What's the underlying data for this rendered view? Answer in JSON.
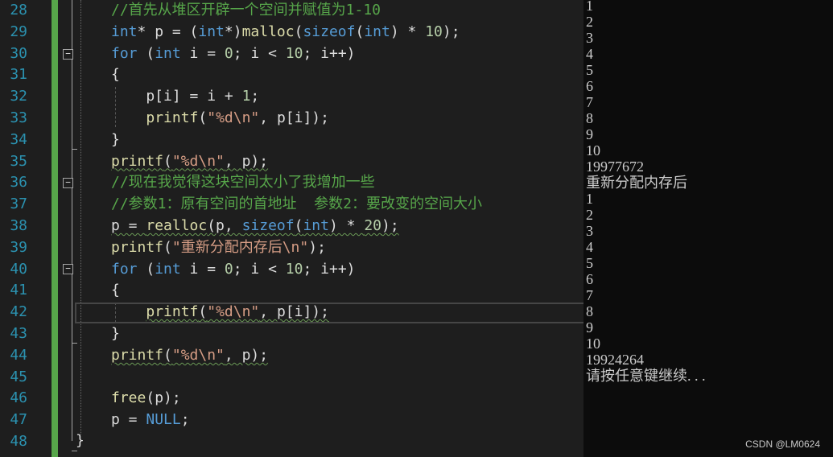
{
  "colors": {
    "keyword": "#569cd6",
    "comment": "#57a64a",
    "string": "#d69d85",
    "identifier": "#dcdcdc",
    "function": "#dcdcaa",
    "number": "#b5cea8",
    "line_number": "#2b91af"
  },
  "editor": {
    "lines": [
      {
        "num": "28",
        "tokens": [
          {
            "t": "//首先从堆区开辟一个空间并赋值为1-10",
            "c": "comment"
          }
        ]
      },
      {
        "num": "29",
        "tokens": [
          {
            "t": "int",
            "c": "keyword"
          },
          {
            "t": "* p = (",
            "c": "identifier"
          },
          {
            "t": "int",
            "c": "keyword"
          },
          {
            "t": "*)",
            "c": "identifier"
          },
          {
            "t": "malloc",
            "c": "function"
          },
          {
            "t": "(",
            "c": "identifier"
          },
          {
            "t": "sizeof",
            "c": "keyword"
          },
          {
            "t": "(",
            "c": "identifier"
          },
          {
            "t": "int",
            "c": "keyword"
          },
          {
            "t": ") * ",
            "c": "identifier"
          },
          {
            "t": "10",
            "c": "number"
          },
          {
            "t": ");",
            "c": "identifier"
          }
        ]
      },
      {
        "num": "30",
        "tokens": [
          {
            "t": "for",
            "c": "keyword"
          },
          {
            "t": " (",
            "c": "identifier"
          },
          {
            "t": "int",
            "c": "keyword"
          },
          {
            "t": " i = ",
            "c": "identifier"
          },
          {
            "t": "0",
            "c": "number"
          },
          {
            "t": "; i < ",
            "c": "identifier"
          },
          {
            "t": "10",
            "c": "number"
          },
          {
            "t": "; i++)",
            "c": "identifier"
          }
        ]
      },
      {
        "num": "31",
        "tokens": [
          {
            "t": "{",
            "c": "identifier"
          }
        ]
      },
      {
        "num": "32",
        "tokens": [
          {
            "t": "    p[i] = i + ",
            "c": "identifier"
          },
          {
            "t": "1",
            "c": "number"
          },
          {
            "t": ";",
            "c": "identifier"
          }
        ]
      },
      {
        "num": "33",
        "tokens": [
          {
            "t": "    ",
            "c": "identifier"
          },
          {
            "t": "printf",
            "c": "function"
          },
          {
            "t": "(",
            "c": "identifier"
          },
          {
            "t": "\"%d\\n\"",
            "c": "string"
          },
          {
            "t": ", p[i]);",
            "c": "identifier"
          }
        ]
      },
      {
        "num": "34",
        "tokens": [
          {
            "t": "}",
            "c": "identifier"
          }
        ]
      },
      {
        "num": "35",
        "squiggle": true,
        "tokens": [
          {
            "t": "printf",
            "c": "function"
          },
          {
            "t": "(",
            "c": "identifier"
          },
          {
            "t": "\"%d\\n\"",
            "c": "string"
          },
          {
            "t": ", p);",
            "c": "identifier"
          }
        ]
      },
      {
        "num": "36",
        "tokens": [
          {
            "t": "//现在我觉得这块空间太小了我增加一些",
            "c": "comment"
          }
        ]
      },
      {
        "num": "37",
        "tokens": [
          {
            "t": "//参数1：原有空间的首地址  参数2：要改变的空间大小",
            "c": "comment"
          }
        ]
      },
      {
        "num": "38",
        "squiggle": true,
        "tokens": [
          {
            "t": "p = ",
            "c": "identifier"
          },
          {
            "t": "realloc",
            "c": "function"
          },
          {
            "t": "(p, ",
            "c": "identifier"
          },
          {
            "t": "sizeof",
            "c": "keyword"
          },
          {
            "t": "(",
            "c": "identifier"
          },
          {
            "t": "int",
            "c": "keyword"
          },
          {
            "t": ") * ",
            "c": "identifier"
          },
          {
            "t": "20",
            "c": "number"
          },
          {
            "t": ");",
            "c": "identifier"
          }
        ]
      },
      {
        "num": "39",
        "tokens": [
          {
            "t": "printf",
            "c": "function"
          },
          {
            "t": "(",
            "c": "identifier"
          },
          {
            "t": "\"重新分配内存后\\n\"",
            "c": "string"
          },
          {
            "t": ");",
            "c": "identifier"
          }
        ]
      },
      {
        "num": "40",
        "tokens": [
          {
            "t": "for",
            "c": "keyword"
          },
          {
            "t": " (",
            "c": "identifier"
          },
          {
            "t": "int",
            "c": "keyword"
          },
          {
            "t": " i = ",
            "c": "identifier"
          },
          {
            "t": "0",
            "c": "number"
          },
          {
            "t": "; i < ",
            "c": "identifier"
          },
          {
            "t": "10",
            "c": "number"
          },
          {
            "t": "; i++)",
            "c": "identifier"
          }
        ]
      },
      {
        "num": "41",
        "tokens": [
          {
            "t": "{",
            "c": "identifier"
          }
        ]
      },
      {
        "num": "42",
        "squiggle": true,
        "tokens": [
          {
            "t": "    ",
            "c": "identifier"
          },
          {
            "t": "printf",
            "c": "function"
          },
          {
            "t": "(",
            "c": "identifier"
          },
          {
            "t": "\"%d\\n\"",
            "c": "string"
          },
          {
            "t": ", p[i]);",
            "c": "identifier"
          }
        ]
      },
      {
        "num": "43",
        "tokens": [
          {
            "t": "}",
            "c": "identifier"
          }
        ]
      },
      {
        "num": "44",
        "squiggle": true,
        "tokens": [
          {
            "t": "printf",
            "c": "function"
          },
          {
            "t": "(",
            "c": "identifier"
          },
          {
            "t": "\"%d\\n\"",
            "c": "string"
          },
          {
            "t": ", p);",
            "c": "identifier"
          }
        ]
      },
      {
        "num": "45",
        "tokens": []
      },
      {
        "num": "46",
        "tokens": [
          {
            "t": "free",
            "c": "function"
          },
          {
            "t": "(p);",
            "c": "identifier"
          }
        ]
      },
      {
        "num": "47",
        "tokens": [
          {
            "t": "p = ",
            "c": "identifier"
          },
          {
            "t": "NULL",
            "c": "keyword"
          },
          {
            "t": ";",
            "c": "identifier"
          }
        ]
      },
      {
        "num": "48",
        "tokens": []
      }
    ]
  },
  "console": {
    "lines": [
      "1",
      "2",
      "3",
      "4",
      "5",
      "6",
      "7",
      "8",
      "9",
      "10",
      "19977672",
      "重新分配内存后",
      "1",
      "2",
      "3",
      "4",
      "5",
      "6",
      "7",
      "8",
      "9",
      "10",
      "19924264",
      "请按任意键继续. . ."
    ]
  },
  "watermark": "CSDN @LM0624"
}
